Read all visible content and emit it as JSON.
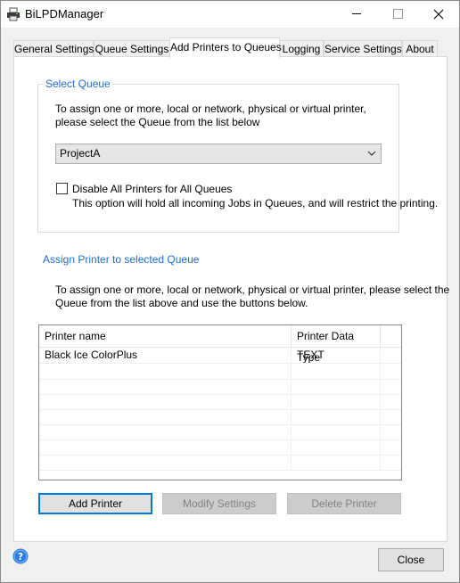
{
  "window": {
    "title": "BiLPDManager"
  },
  "tabs": [
    {
      "label": "General Settings"
    },
    {
      "label": "Queue Settings"
    },
    {
      "label": "Add Printers to Queues",
      "active": true
    },
    {
      "label": "Logging"
    },
    {
      "label": "Service Settings"
    },
    {
      "label": "About"
    }
  ],
  "select_queue": {
    "legend": "Select Queue",
    "instruction_line1": "To assign one or more, local or network, physical or virtual printer,",
    "instruction_line2": "please select the Queue from the list below",
    "selected_queue": "ProjectA",
    "disable_all_label": "Disable All Printers for All Queues",
    "disable_all_checked": false,
    "disable_all_note": "This option will hold all incoming Jobs in Queues, and will restrict the printing."
  },
  "assign": {
    "title": "Assign Printer to selected Queue",
    "instruction_line1": "To assign one or more, local or network, physical or virtual printer, please select the",
    "instruction_line2": "Queue from the list above and use the buttons below."
  },
  "printer_list": {
    "columns": [
      "Printer name",
      "Printer Data Type"
    ],
    "rows": [
      {
        "name": "Black Ice ColorPlus",
        "type": "TEXT"
      }
    ]
  },
  "buttons": {
    "add_printer": "Add Printer",
    "modify_settings": "Modify Settings",
    "delete_printer": "Delete Printer",
    "close": "Close"
  },
  "colors": {
    "accent": "#0078d7",
    "section_text": "#1e6fd9"
  },
  "icons": {
    "app": "printer-icon",
    "help": "help-icon",
    "dropdown": "chevron-down-icon"
  }
}
